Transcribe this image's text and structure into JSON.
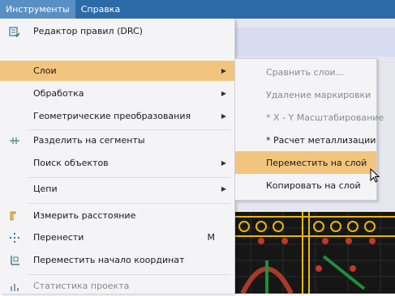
{
  "menubar": {
    "items": [
      {
        "label": "Инструменты"
      },
      {
        "label": "Справка"
      }
    ]
  },
  "dropdown": {
    "items": [
      {
        "label": "Редактор правил (DRC)",
        "icon": "drc-rules-icon"
      },
      {
        "label": "Слои",
        "submenu": true,
        "highlighted": true
      },
      {
        "label": "Обработка",
        "submenu": true
      },
      {
        "label": "Геометрические преобразования",
        "submenu": true
      },
      {
        "label": "Разделить на сегменты",
        "icon": "split-segments-icon"
      },
      {
        "label": "Поиск объектов",
        "submenu": true
      },
      {
        "label": "Цепи",
        "submenu": true
      },
      {
        "label": "Измерить расстояние",
        "icon": "ruler-icon"
      },
      {
        "label": "Перенести",
        "shortcut": "M",
        "icon": "move-icon"
      },
      {
        "label": "Переместить начало координат",
        "icon": "origin-icon"
      },
      {
        "label": "Статистика проекта",
        "icon": "statistics-icon",
        "disabled": true
      }
    ]
  },
  "submenu": {
    "items": [
      {
        "label": "Сравнить слои...",
        "disabled": true
      },
      {
        "label": "Удаление маркировки",
        "disabled": true
      },
      {
        "label": "* X - Y Масштабирование",
        "disabled": true
      },
      {
        "label": "* Расчет металлизации"
      },
      {
        "label": "Переместить на слой",
        "highlighted": true
      },
      {
        "label": "Копировать на слой"
      }
    ]
  },
  "colors": {
    "menubar": "#2d6aa8",
    "highlight": "#f2c57e",
    "pcb_trace": "#e8b800",
    "pcb_pad": "#c0392b"
  }
}
